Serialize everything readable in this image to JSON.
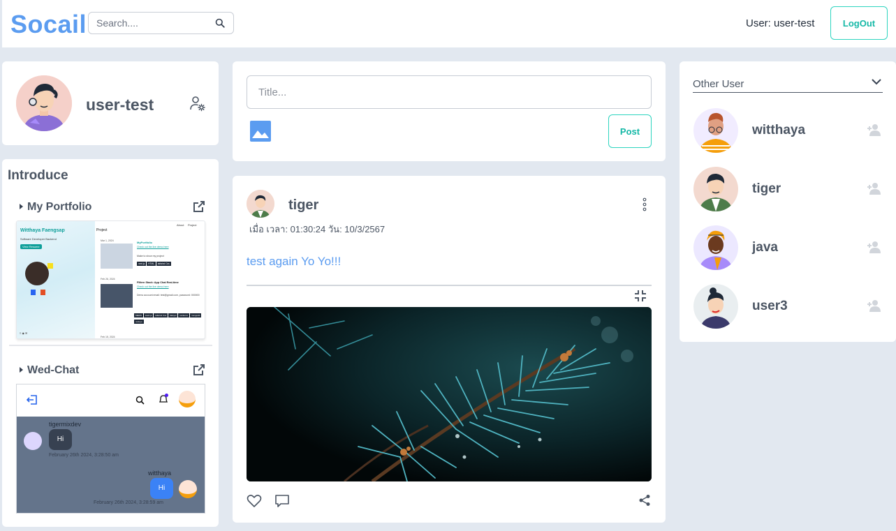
{
  "header": {
    "brand": "Socail",
    "search_placeholder": "Search....",
    "user_label": "User: user-test",
    "logout_label": "LogOut"
  },
  "profile": {
    "username": "user-test"
  },
  "introduce": {
    "title": "Introduce",
    "items": [
      {
        "label": "My Portfolio",
        "preview": {
          "site_title": "Witthaya Faengsap",
          "subtitle": "Software Developer  Backend",
          "view_button": "View Resume",
          "nav": [
            "About",
            "Project"
          ],
          "heading": "Project",
          "entries": [
            {
              "date": "Mar 1, 2024",
              "title": "MyPortfolio",
              "link": "Check out the live demo here",
              "desc": "Make to show my project",
              "tags": [
                "next.js",
                "HTML",
                "tailwind Css"
              ]
            },
            {
              "date": "Feb 26, 2024",
              "title": "FMern Stack: App Chat Real-time",
              "link": "Check out the live demo here",
              "desc": "Demo account email: test@gmail.com, password: 000000",
              "tags": [
                "MERN",
                "react.js",
                "tailwind Css",
                "daisyui",
                "socket.io",
                "mongodb",
                "node.js"
              ]
            },
            {
              "date": "Feb 15, 2024",
              "title": "",
              "link": "",
              "desc": "",
              "tags": []
            }
          ]
        }
      },
      {
        "label": "Wed-Chat",
        "preview": {
          "messages": [
            {
              "sender": "tigermixdev",
              "text": "Hi",
              "time": "February 26th 2024, 3:28:50 am",
              "side": "left"
            },
            {
              "sender": "witthaya",
              "text": "Hi",
              "time": "February 26th 2024, 3:28:59 am",
              "side": "right"
            }
          ]
        }
      }
    ]
  },
  "composer": {
    "title_placeholder": "Title...",
    "post_label": "Post"
  },
  "post": {
    "author": "tiger",
    "time": "เมื่อ เวลา: 01:30:24 วัน: 10/3/2567",
    "text": "test again Yo Yo!!!"
  },
  "other_users": {
    "label": "Other User",
    "users": [
      {
        "name": "witthaya",
        "bg": "#f1ecff"
      },
      {
        "name": "tiger",
        "bg": "#f3d9cf"
      },
      {
        "name": "java",
        "bg": "#ece8ff"
      },
      {
        "name": "user3",
        "bg": "#e9eef0"
      }
    ]
  },
  "colors": {
    "brand": "#5b9cf0",
    "accent": "#14b8a6",
    "background": "#e2e8f0"
  }
}
